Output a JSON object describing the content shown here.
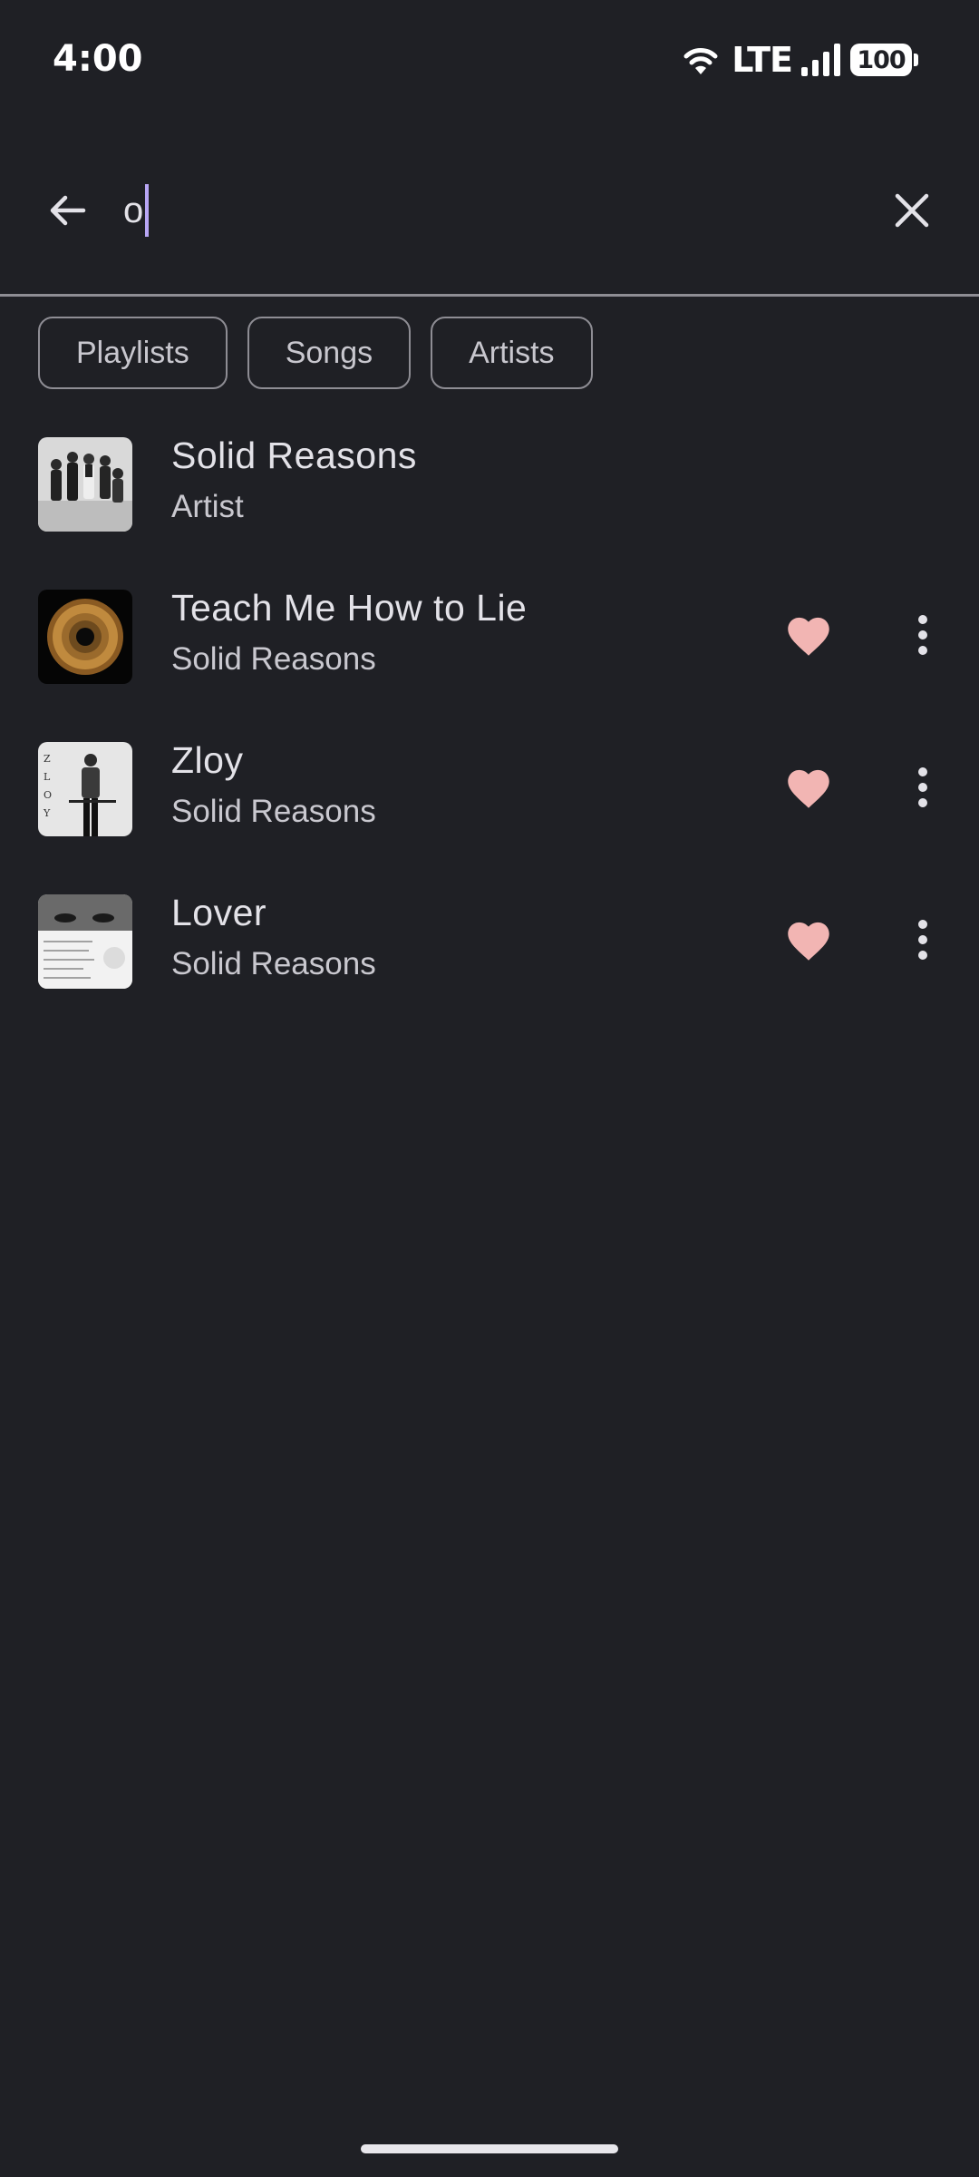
{
  "status_bar": {
    "time": "4:00",
    "network": "LTE",
    "battery": "100"
  },
  "search": {
    "query": "o",
    "back_icon": "arrow-back-icon",
    "clear_icon": "close-icon"
  },
  "filters": [
    {
      "label": "Playlists"
    },
    {
      "label": "Songs"
    },
    {
      "label": "Artists"
    }
  ],
  "results": [
    {
      "title": "Solid Reasons",
      "subtitle": "Artist",
      "type": "artist"
    },
    {
      "title": "Teach Me How to Lie",
      "subtitle": "Solid Reasons",
      "type": "song",
      "liked": true
    },
    {
      "title": "Zloy",
      "subtitle": "Solid Reasons",
      "type": "song",
      "liked": true
    },
    {
      "title": "Lover",
      "subtitle": "Solid Reasons",
      "type": "song",
      "liked": true
    }
  ],
  "colors": {
    "background": "#1f2025",
    "heart": "#f2b5b3",
    "caret": "#b8a6f5",
    "chip_border": "#8e8d94"
  }
}
